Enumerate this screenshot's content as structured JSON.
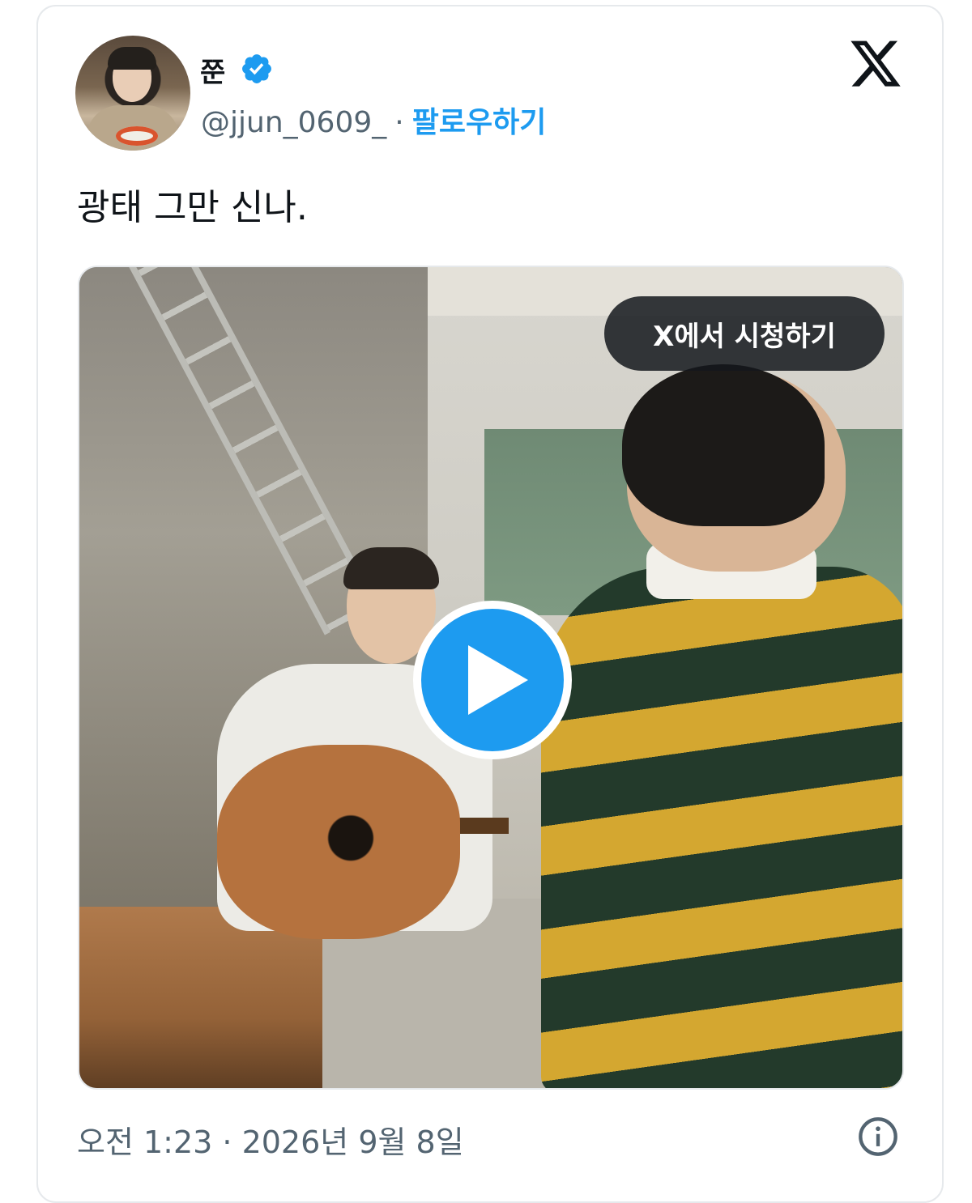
{
  "author": {
    "display_name": "쭌",
    "handle": "@jjun_0609_",
    "separator": "·",
    "follow_label": "팔로우하기",
    "verified": true,
    "avatar_icon": "profile-photo"
  },
  "tweet": {
    "text": "광태 그만 신나."
  },
  "media": {
    "watch_label": "X에서 시청하기",
    "play_icon": "play-icon"
  },
  "footer": {
    "timestamp": "오전 1:23 · 2026년 9월 8일",
    "info_icon": "info-icon"
  },
  "colors": {
    "accent": "#1d9bf0",
    "text_primary": "#0f1419",
    "text_secondary": "#536471",
    "border": "#e6e9ec"
  }
}
